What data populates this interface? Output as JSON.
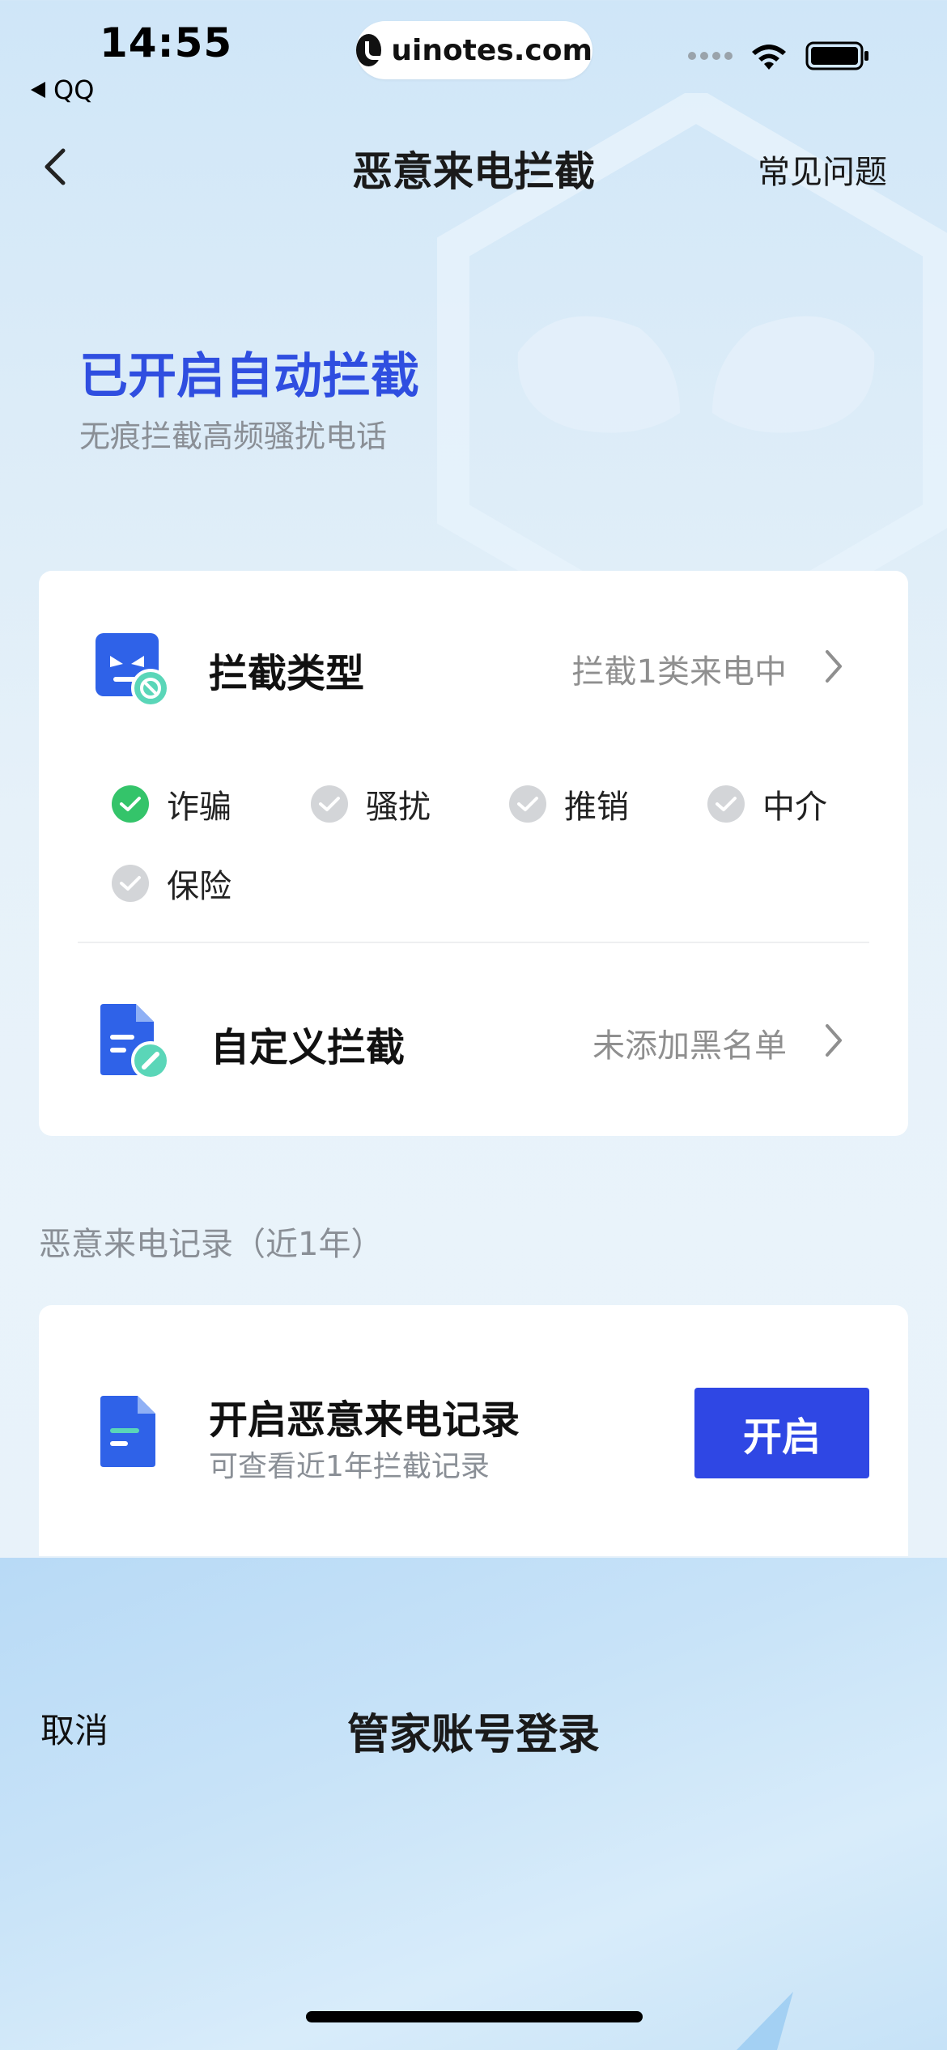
{
  "status_bar": {
    "time": "14:55",
    "back_app": "QQ",
    "url": "uinotes.com",
    "icons": [
      "signal-dots-icon",
      "wifi-icon",
      "battery-icon"
    ]
  },
  "nav": {
    "title": "恶意来电拦截",
    "faq": "常见问题"
  },
  "hero": {
    "title": "已开启自动拦截",
    "subtitle": "无痕拦截高频骚扰电话"
  },
  "intercept_card": {
    "type_row": {
      "title": "拦截类型",
      "status": "拦截1类来电中"
    },
    "categories": [
      {
        "label": "诈骗",
        "checked": true
      },
      {
        "label": "骚扰",
        "checked": false
      },
      {
        "label": "推销",
        "checked": false
      },
      {
        "label": "中介",
        "checked": false
      },
      {
        "label": "保险",
        "checked": false
      }
    ],
    "custom_row": {
      "title": "自定义拦截",
      "status": "未添加黑名单"
    }
  },
  "records": {
    "section_label": "恶意来电记录（近1年）",
    "title": "开启恶意来电记录",
    "subtitle": "可查看近1年拦截记录",
    "button": "开启"
  },
  "login_sheet": {
    "cancel": "取消",
    "title": "管家账号登录"
  },
  "colors": {
    "accent": "#2f47e4",
    "hero_title": "#2f4ee0",
    "check_on": "#34c46a",
    "check_off": "#d3d5d8",
    "icon_blue": "#2f62e8",
    "icon_teal": "#5ad6b8"
  }
}
